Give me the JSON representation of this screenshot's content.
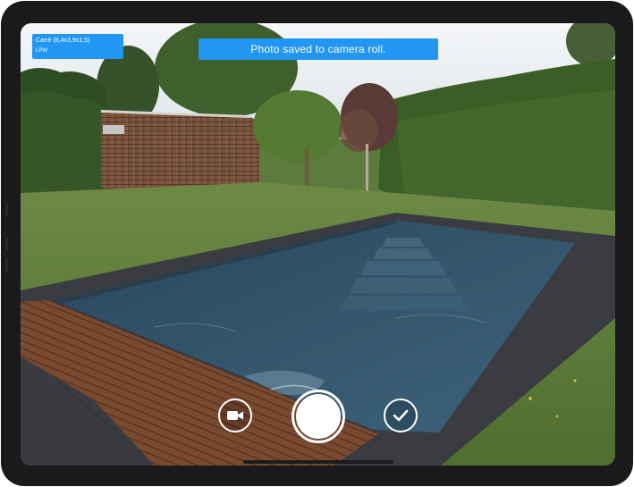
{
  "info_card": {
    "model": "Carré (8,4x3,9x1,5)",
    "finish": "LPW"
  },
  "toast": {
    "message": "Photo saved to camera roll."
  },
  "controls": {
    "video": {
      "icon": "video-camera-icon"
    },
    "shutter": {
      "icon": "shutter-button"
    },
    "confirm": {
      "icon": "checkmark-icon"
    }
  },
  "colors": {
    "accent": "#2196f3",
    "device_frame": "#1a1a1c",
    "water": "#2d4b60",
    "coping": "#3b3c41",
    "deck": "#7a4a30"
  }
}
